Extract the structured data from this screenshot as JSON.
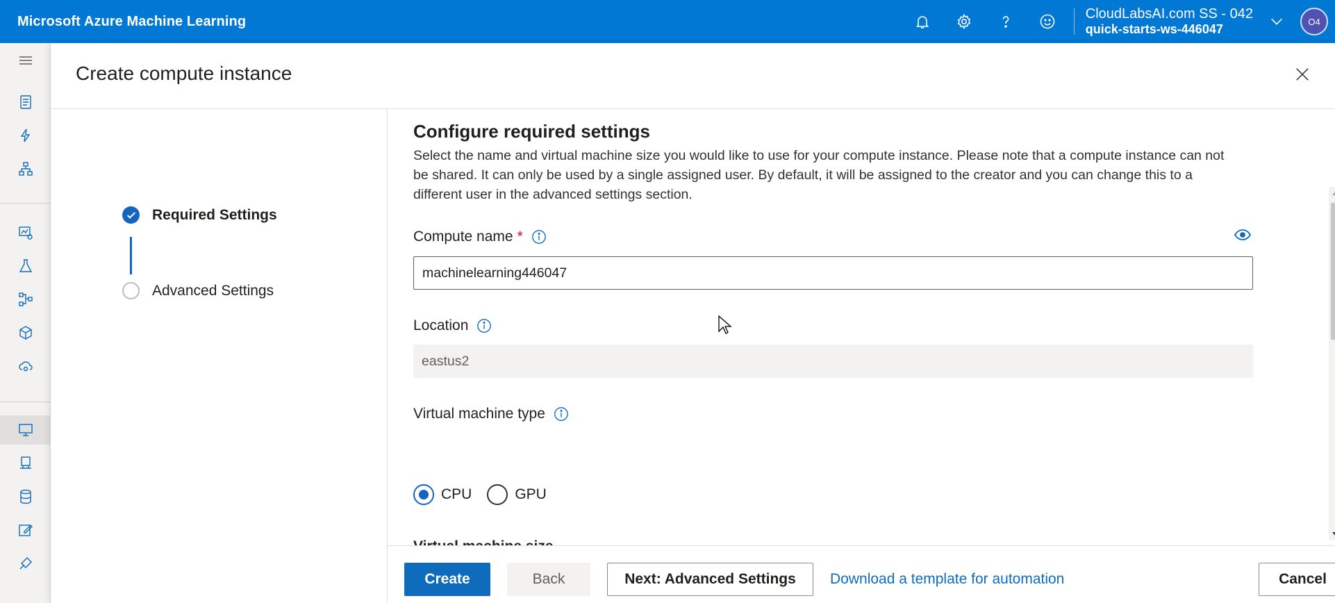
{
  "topbar": {
    "brand": "Microsoft Azure Machine Learning",
    "icons": [
      "bell-icon",
      "gear-icon",
      "help-icon",
      "smiley-icon"
    ],
    "account_name": "CloudLabsAI.com SS - 042",
    "workspace": "quick-starts-ws-446047",
    "avatar_initials": "O4"
  },
  "panel": {
    "title": "Create compute instance"
  },
  "steps": [
    {
      "label": "Required Settings",
      "state": "done"
    },
    {
      "label": "Advanced Settings",
      "state": "todo"
    }
  ],
  "content": {
    "section_title": "Configure required settings",
    "description": "Select the name and virtual machine size you would like to use for your compute instance. Please note that a compute instance can not be shared. It can only be used by a single assigned user. By default, it will be assigned to the creator and you can change this to a different user in the advanced settings section.",
    "compute_name": {
      "label": "Compute name",
      "required_mark": "*",
      "value": "machinelearning446047"
    },
    "location": {
      "label": "Location",
      "value": "eastus2"
    },
    "vm_type": {
      "label": "Virtual machine type",
      "options": [
        "CPU",
        "GPU"
      ],
      "selected": "CPU"
    },
    "vm_size": {
      "label": "Virtual machine size"
    }
  },
  "footer": {
    "create": "Create",
    "back": "Back",
    "next": "Next: Advanced Settings",
    "download_link": "Download a template for automation",
    "cancel": "Cancel"
  },
  "colors": {
    "topbar": "#0078d4",
    "primary": "#0f6cbd",
    "required": "#c50f1f"
  }
}
